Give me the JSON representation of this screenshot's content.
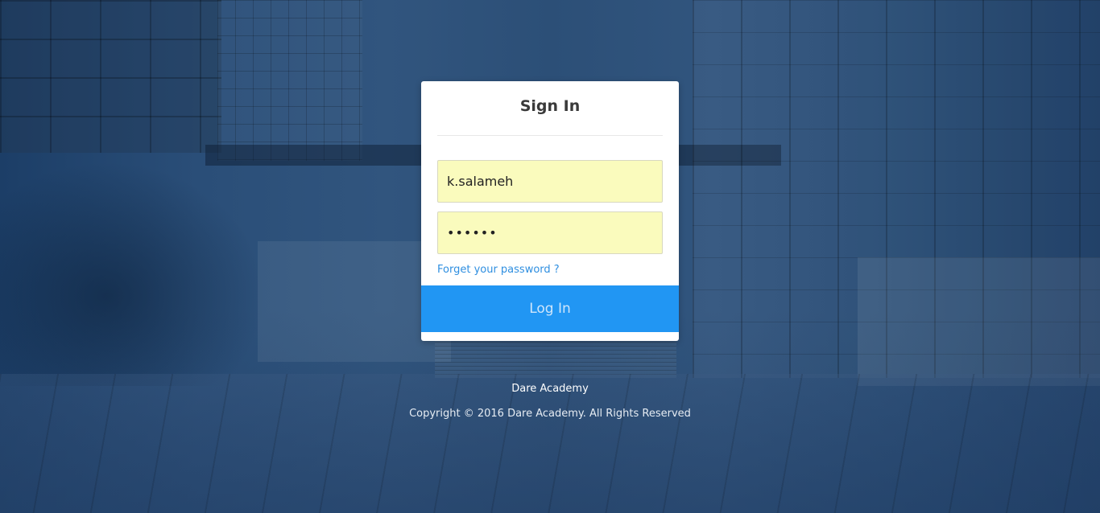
{
  "login_card": {
    "title": "Sign In",
    "username_value": "k.salameh",
    "password_value": "••••••",
    "forgot_link": "Forget your password ?",
    "login_button": "Log In"
  },
  "footer": {
    "brand": "Dare Academy",
    "copyright": "Copyright © 2016 Dare Academy. All Rights Reserved"
  },
  "colors": {
    "primary_button": "#2196f3",
    "link": "#2f8fe0",
    "autofill_field": "#fafbbd",
    "background_tint": "#2a4e78"
  }
}
